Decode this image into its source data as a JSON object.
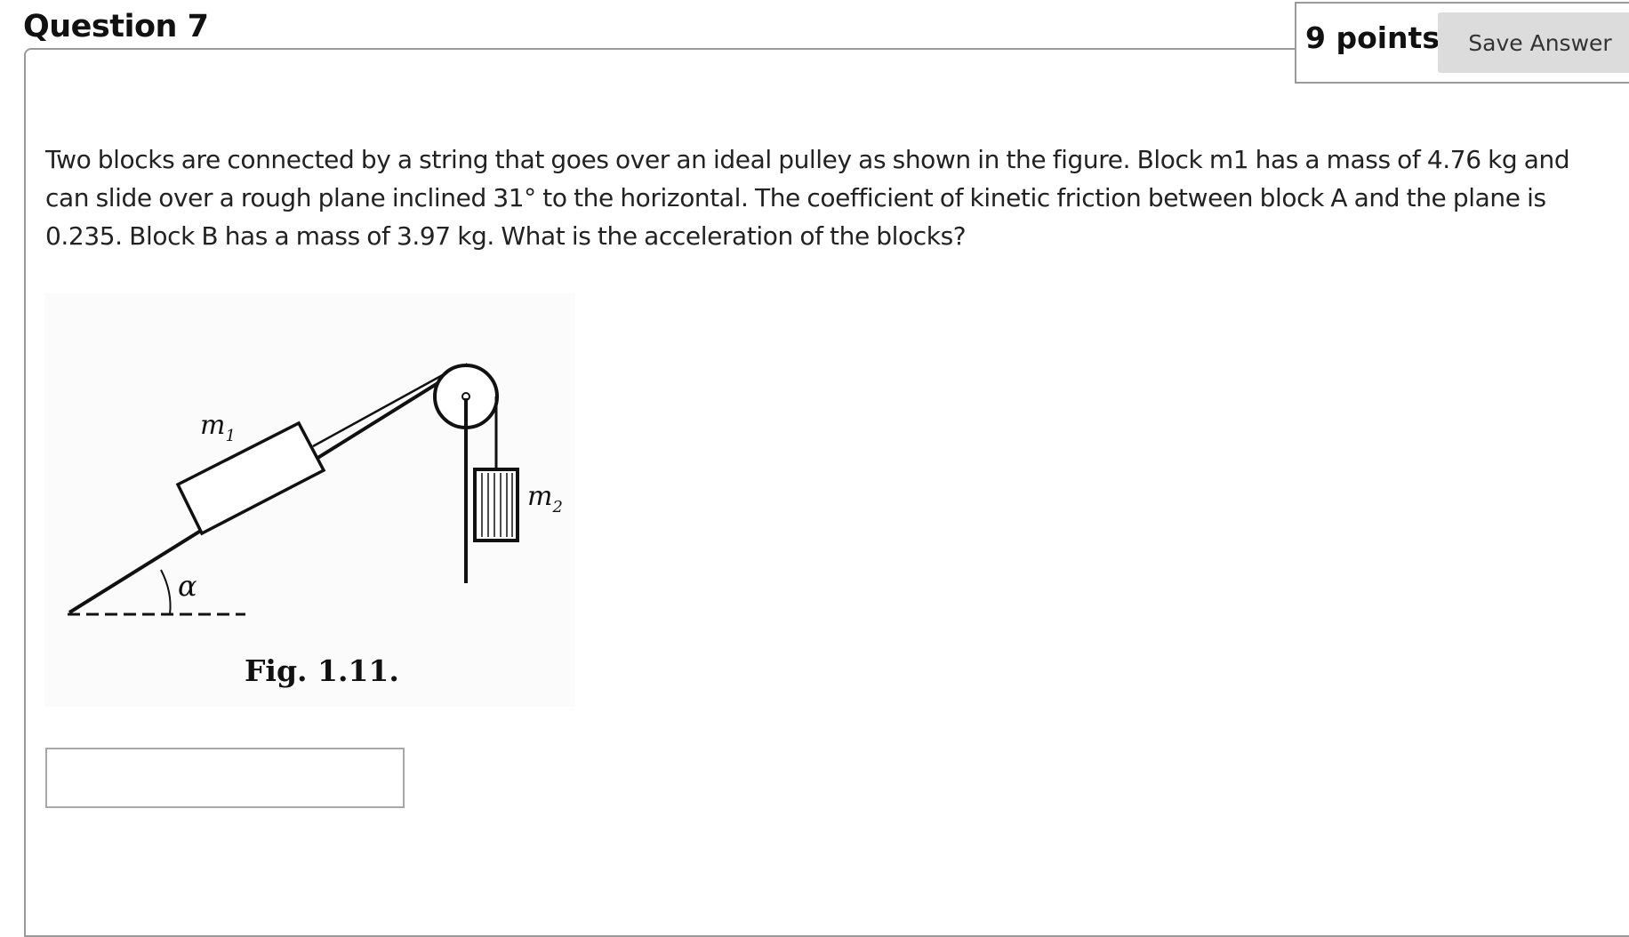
{
  "question": {
    "title": "Question 7",
    "points": "9 points",
    "save_label": "Save Answer",
    "text": "Two blocks are connected by a string that goes over an ideal pulley as shown in the figure. Block m1 has a mass of 4.76 kg and can slide over a rough plane inclined 31° to the horizontal. The coefficient of kinetic friction between block A and the plane is 0.235. Block B has a mass of 3.97 kg. What is the acceleration of the blocks?"
  },
  "figure": {
    "label_m1": "m",
    "label_m1_sub": "1",
    "label_m2": "m",
    "label_m2_sub": "2",
    "label_angle": "α",
    "caption": "Fig. 1.11."
  },
  "answer": {
    "value": "",
    "placeholder": ""
  }
}
